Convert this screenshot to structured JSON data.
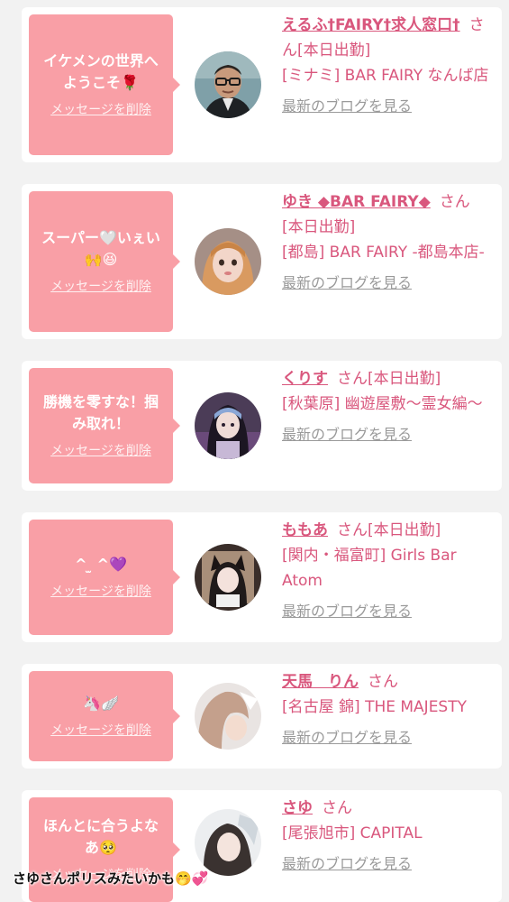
{
  "cards": [
    {
      "message": "イケメンの世界へようこそ🌹",
      "delete_label": "メッセージを削除",
      "name": "えるふ†FAIRY†求人窓口†",
      "san": "さん",
      "status": "[本日出勤]",
      "shop": "[ミナミ] BAR FAIRY なんば店",
      "blog_link": "最新のブログを見る",
      "avatar_icon": "man-with-glasses-photo"
    },
    {
      "message": "スーパー🤍いぇい🙌😆",
      "delete_label": "メッセージを削除",
      "name": "ゆき ◆BAR FAIRY◆",
      "san": "さん",
      "status": "[本日出勤]",
      "shop": "[都島] BAR FAIRY -都島本店-",
      "blog_link": "最新のブログを見る",
      "avatar_icon": "woman-selfie-photo"
    },
    {
      "message": "勝機を零すな！掴み取れ！",
      "delete_label": "メッセージを削除",
      "name": "くりす",
      "san": "さん",
      "status": "[本日出勤]",
      "shop": "[秋葉原] 幽遊屋敷〜霊女編〜",
      "blog_link": "最新のブログを見る",
      "avatar_icon": "cosplay-woman-photo"
    },
    {
      "message": "^ ̫ ^💜",
      "delete_label": "メッセージを削除",
      "name": "ももあ",
      "san": "さん",
      "status": "[本日出勤]",
      "shop": "[関内・福富町] Girls Bar Atom",
      "blog_link": "最新のブログを見る",
      "avatar_icon": "cat-ear-woman-photo"
    },
    {
      "message": "🦄🪽",
      "delete_label": "メッセージを削除",
      "name": "天馬　りん",
      "san": "さん",
      "status": "",
      "shop": "[名古屋 錦] THE MAJESTY",
      "blog_link": "最新のブログを見る",
      "avatar_icon": "woman-hair-photo"
    },
    {
      "message": "ほんとに合うよなあ🥺",
      "delete_label": "メッセージを削除",
      "name": "さゆ",
      "san": "さん",
      "status": "",
      "shop": "[尾張旭市] CAPITAL",
      "blog_link": "最新のブログを見る",
      "avatar_icon": "woman-portrait-photo"
    }
  ],
  "overlay_caption": "さゆさんポリスみたいかも🤭💞"
}
